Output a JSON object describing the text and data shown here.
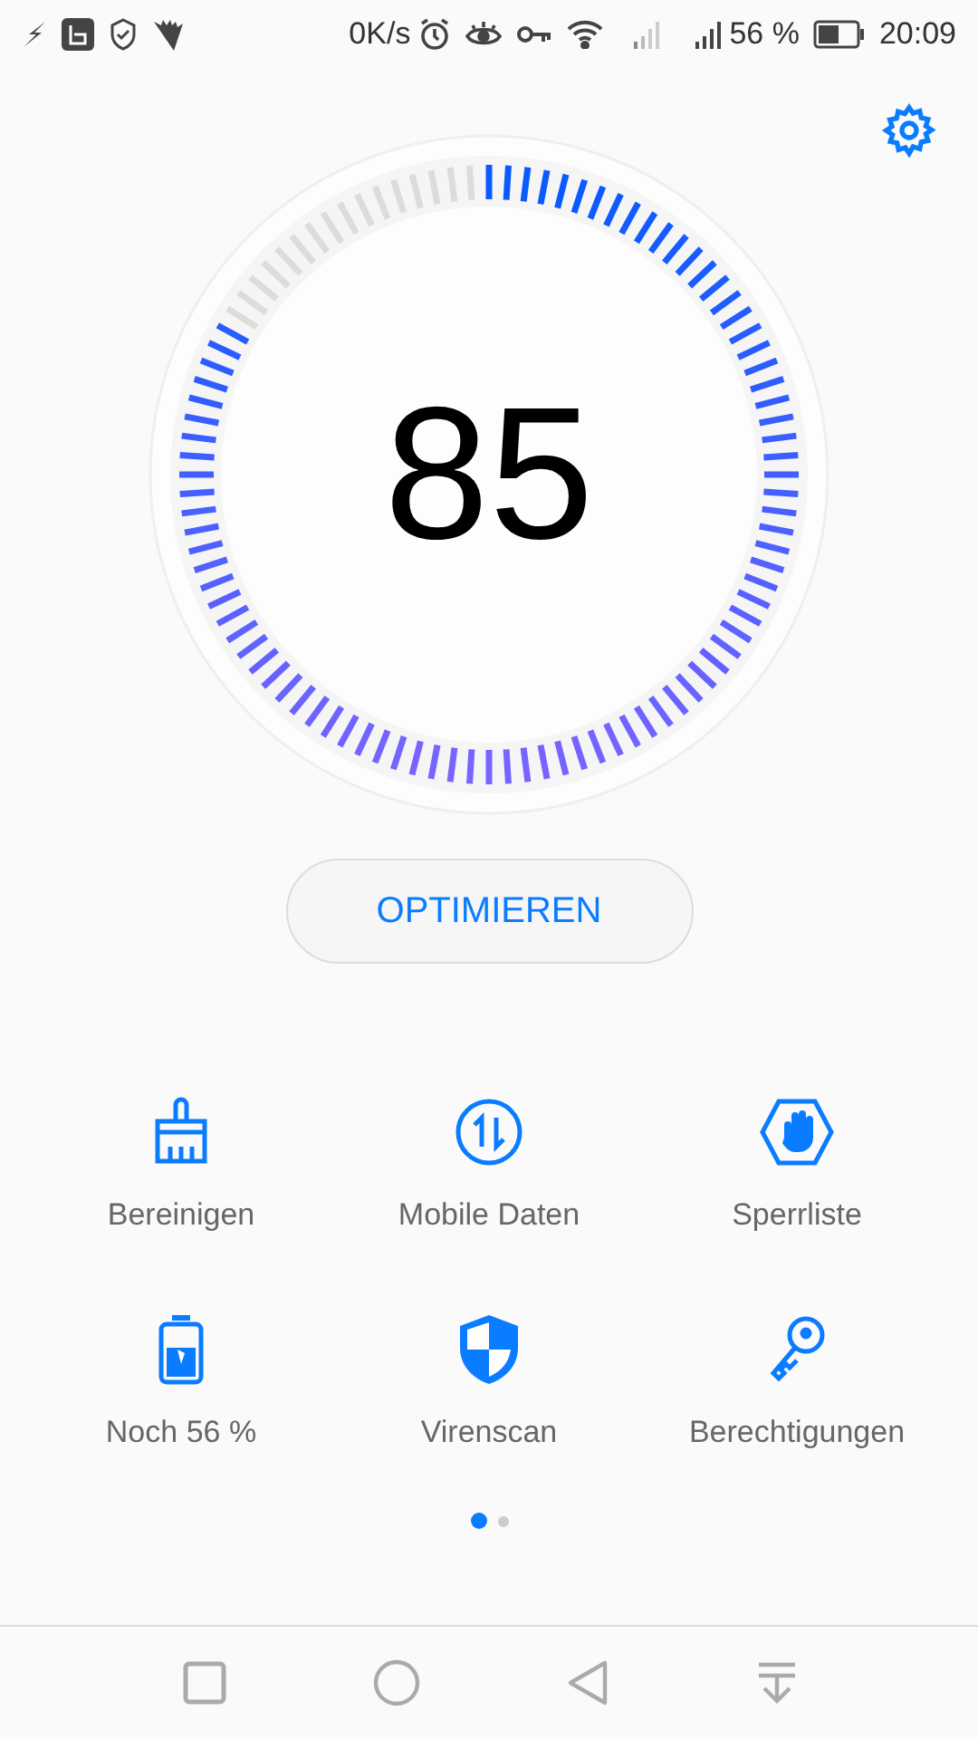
{
  "status_bar": {
    "net_speed": "0K/s",
    "battery": "56 %",
    "time": "20:09"
  },
  "gauge": {
    "score": "85"
  },
  "optimize_button": "OPTIMIEREN",
  "tiles": [
    {
      "kind": "broom",
      "label": "Bereinigen"
    },
    {
      "kind": "data",
      "label": "Mobile Daten"
    },
    {
      "kind": "block",
      "label": "Sperrliste"
    },
    {
      "kind": "battery",
      "label": "Noch 56 %"
    },
    {
      "kind": "shield",
      "label": "Virenscan"
    },
    {
      "kind": "key",
      "label": "Berechtigungen"
    }
  ],
  "page_dots": [
    {
      "selected": true
    },
    {
      "selected": false
    }
  ]
}
